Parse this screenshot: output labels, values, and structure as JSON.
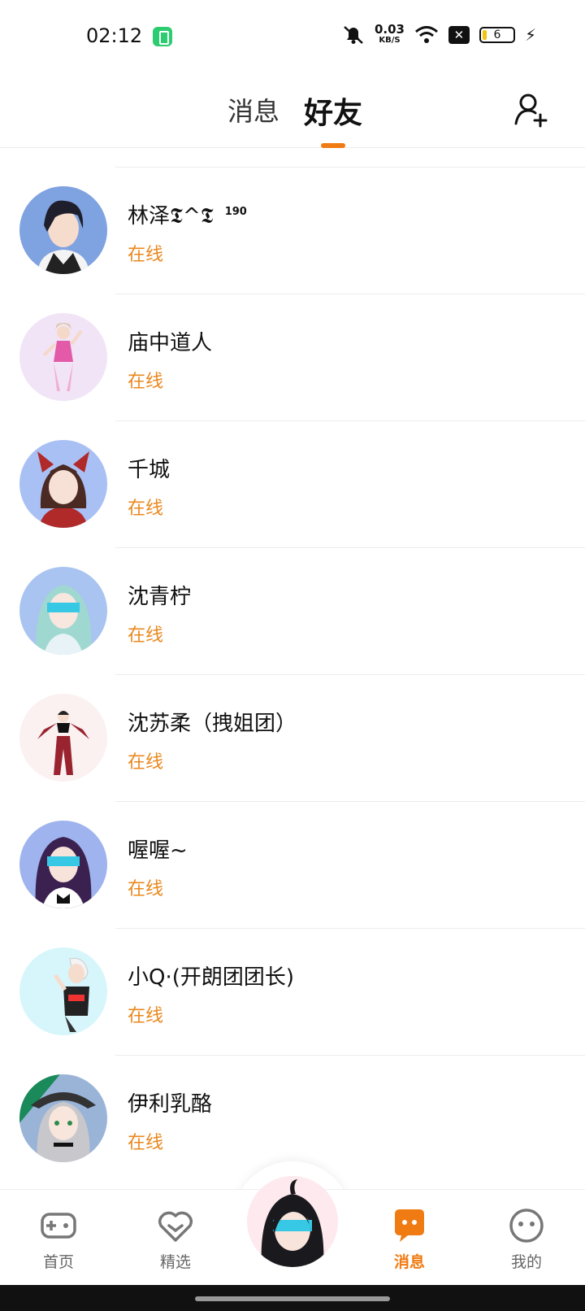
{
  "status_bar": {
    "time": "02:12",
    "net_speed_value": "0.03",
    "net_speed_unit": "KB/S",
    "battery_level": "6"
  },
  "header": {
    "tab_messages": "消息",
    "tab_friends": "好友",
    "active_tab": "好友"
  },
  "friends": [
    {
      "name": "林泽𝕿^𝕿",
      "level": "190",
      "status": "在线",
      "avatar_colors": [
        "#7fa2e0",
        "#2a2a3a"
      ]
    },
    {
      "name": "庙中道人",
      "status": "在线",
      "avatar_colors": [
        "#f1e4f7",
        "#e25aa8"
      ]
    },
    {
      "name": "千城",
      "status": "在线",
      "avatar_colors": [
        "#a9c0f5",
        "#b02a2a"
      ]
    },
    {
      "name": "沈青柠",
      "status": "在线",
      "avatar_colors": [
        "#a9c4f0",
        "#9fd8d0"
      ]
    },
    {
      "name": "沈苏柔（拽姐团）",
      "status": "在线",
      "avatar_colors": [
        "#fbf1f1",
        "#9a2330"
      ]
    },
    {
      "name": "喔喔~",
      "status": "在线",
      "avatar_colors": [
        "#9fb4ee",
        "#3b2150"
      ]
    },
    {
      "name": "小Q·(开朗团团长)",
      "status": "在线",
      "avatar_colors": [
        "#d6f6fb",
        "#222222"
      ]
    },
    {
      "name": "伊利乳酪",
      "status": "在线",
      "avatar_colors": [
        "#9ab4d8",
        "#1a8a5a"
      ]
    }
  ],
  "bottom_nav": {
    "home": "首页",
    "featured": "精选",
    "messages": "消息",
    "mine": "我的",
    "active": "消息"
  },
  "colors": {
    "accent": "#f07b12",
    "online": "#e9881e"
  }
}
